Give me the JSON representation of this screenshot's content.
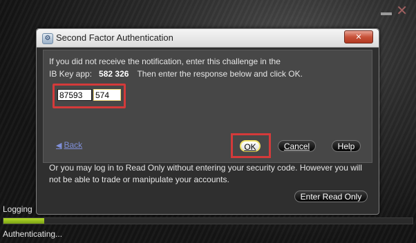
{
  "dialog": {
    "title": "Second Factor Authentication",
    "close_glyph": "✕",
    "message_line1": "If you did not receive the notification, enter this challenge in the",
    "message_line2_prefix": "IB Key app:",
    "challenge_code": "582 326",
    "message_line2_suffix": "Then enter the response below and click OK.",
    "response_part1": "87593",
    "response_part2": "574",
    "back_label": "Back",
    "ok_label": "OK",
    "cancel_label": "Cancel",
    "help_label": "Help",
    "readonly_line1": "Or you may log in to Read Only without entering your security code. However you will",
    "readonly_line2": "not be able to trade or manipulate your accounts.",
    "enter_readonly_label": "Enter Read Only"
  },
  "status": {
    "logging_text": "Logging",
    "progress_fraction": 0.1,
    "authenticating_text": "Authenticating..."
  },
  "colors": {
    "highlight": "#d43a3a",
    "progress": "#9cc81f",
    "link": "#7f8fd9"
  }
}
